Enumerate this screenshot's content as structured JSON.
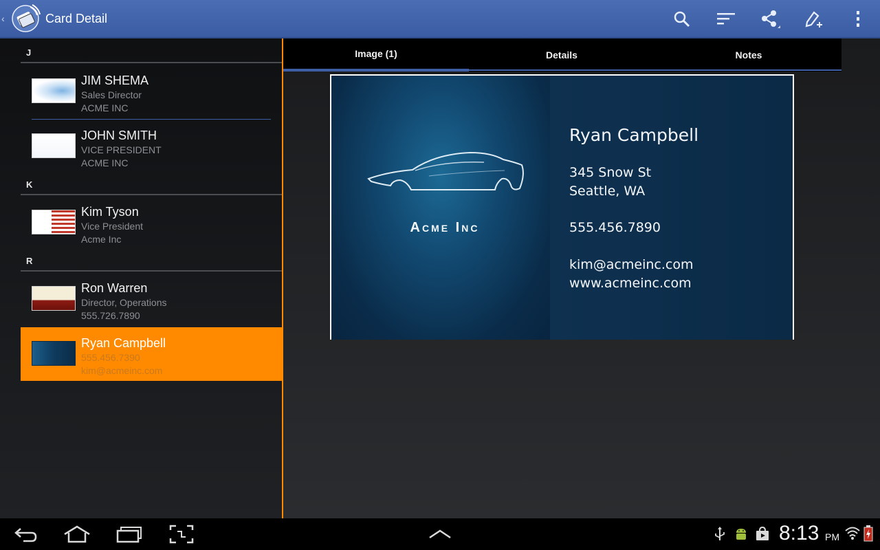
{
  "app": {
    "title": "Card Detail",
    "accent": "#ff8a00",
    "action_bar_color": "#3b5ca3",
    "up_glyph": "‹"
  },
  "actions": [
    {
      "name": "search-icon",
      "label": "Search"
    },
    {
      "name": "sort-icon",
      "label": "Sort"
    },
    {
      "name": "share-icon",
      "label": "Share"
    },
    {
      "name": "edit-add-icon",
      "label": "Edit"
    },
    {
      "name": "overflow-menu-icon",
      "label": "More options"
    }
  ],
  "list": {
    "sections": [
      {
        "letter": "J",
        "contacts": [
          {
            "name": "JIM SHEMA",
            "line2": "Sales Director",
            "line3": "ACME INC",
            "thumb": "blue-white-card"
          },
          {
            "name": "JOHN SMITH",
            "line2": "VICE PRESIDENT",
            "line3": "ACME INC",
            "thumb": "white-card"
          }
        ]
      },
      {
        "letter": "K",
        "contacts": [
          {
            "name": "Kim Tyson",
            "line2": "Vice President",
            "line3": "Acme Inc",
            "thumb": "flag-card"
          }
        ]
      },
      {
        "letter": "R",
        "contacts": [
          {
            "name": "Ron Warren",
            "line2": "Director, Operations",
            "line3": "555.726.7890",
            "thumb": "cream-red-card"
          },
          {
            "name": "Ryan Campbell",
            "line2": "555.456.7390",
            "line3": "kim@acmeinc.com",
            "thumb": "dark-blue-card",
            "selected": true
          }
        ]
      }
    ]
  },
  "tabs": [
    {
      "label": "Image (1)",
      "active": true
    },
    {
      "label": "Details",
      "active": false
    },
    {
      "label": "Notes",
      "active": false
    }
  ],
  "card": {
    "company": "Acme Inc",
    "name": "Ryan Campbell",
    "address1": "345 Snow St",
    "address2": "Seattle, WA",
    "phone": "555.456.7890",
    "email": "kim@acmeinc.com",
    "website": "www.acmeinc.com",
    "logo": "car-silhouette-icon"
  },
  "navbar": {
    "buttons": [
      {
        "name": "back-icon"
      },
      {
        "name": "home-icon"
      },
      {
        "name": "recent-apps-icon"
      },
      {
        "name": "screenshot-icon"
      },
      {
        "name": "expand-up-icon"
      }
    ],
    "status_icons": [
      "usb-icon",
      "android-debug-icon",
      "store-icon",
      "wifi-icon",
      "battery-icon"
    ],
    "time": "8:13",
    "ampm": "PM"
  }
}
